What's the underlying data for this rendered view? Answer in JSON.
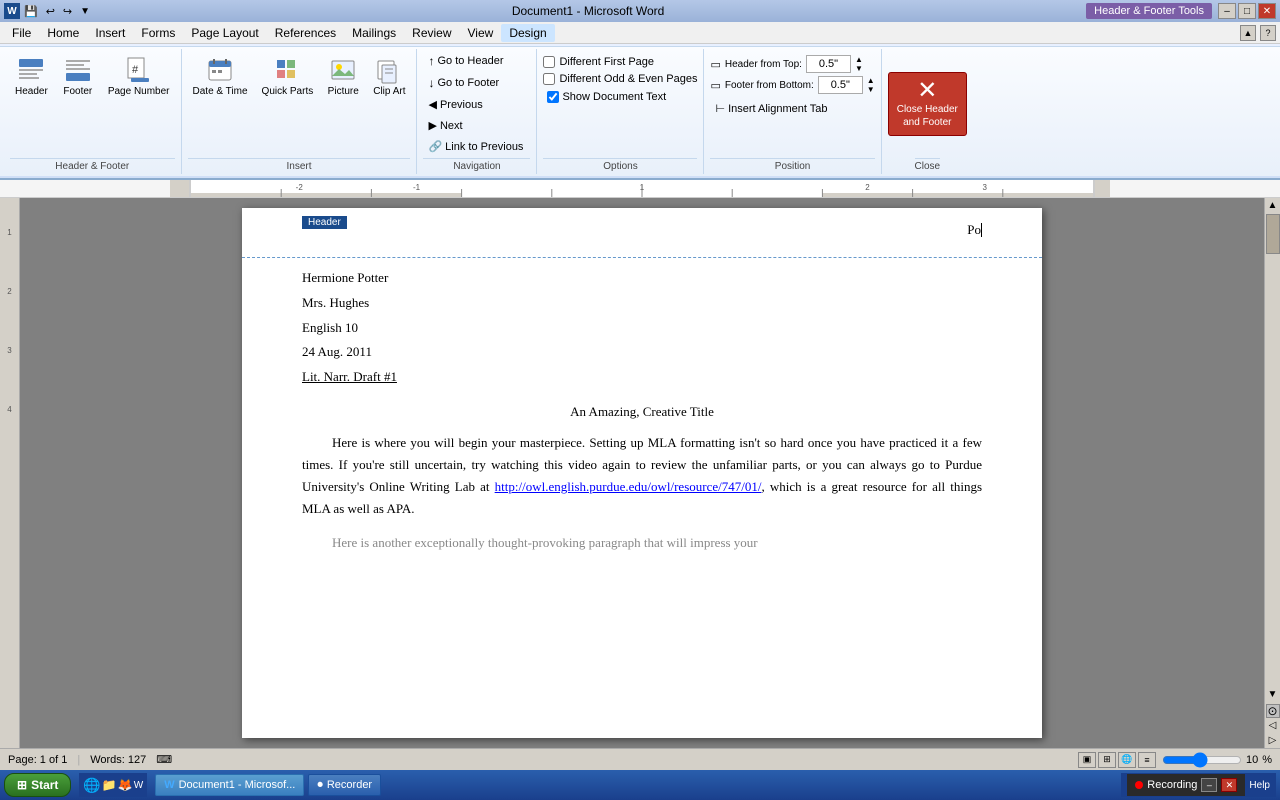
{
  "title_bar": {
    "doc_name": "Document1 - Microsoft Word",
    "header_footer_badge": "Header & Footer Tools",
    "min_btn": "–",
    "max_btn": "□",
    "close_btn": "✕"
  },
  "quick_access": {
    "save": "💾",
    "undo": "↩",
    "redo": "↪"
  },
  "ribbon": {
    "tabs": [
      {
        "label": "File",
        "id": "file"
      },
      {
        "label": "Home",
        "id": "home"
      },
      {
        "label": "Insert",
        "id": "insert"
      },
      {
        "label": "Forms",
        "id": "forms"
      },
      {
        "label": "Page Layout",
        "id": "page-layout"
      },
      {
        "label": "References",
        "id": "references"
      },
      {
        "label": "Mailings",
        "id": "mailings"
      },
      {
        "label": "Review",
        "id": "review"
      },
      {
        "label": "View",
        "id": "view"
      },
      {
        "label": "Design",
        "id": "design",
        "active": true
      }
    ],
    "groups": {
      "header_footer": {
        "label": "Header & Footer",
        "buttons": [
          {
            "id": "header",
            "label": "Header",
            "icon": "▭"
          },
          {
            "id": "footer",
            "label": "Footer",
            "icon": "▭"
          },
          {
            "id": "page-number",
            "label": "Page Number",
            "icon": "#"
          }
        ]
      },
      "insert": {
        "label": "Insert",
        "buttons": [
          {
            "id": "date-time",
            "label": "Date & Time",
            "icon": "📅"
          },
          {
            "id": "quick-parts",
            "label": "Quick Parts",
            "icon": "⬛"
          },
          {
            "id": "picture",
            "label": "Picture",
            "icon": "🖼"
          },
          {
            "id": "clip-art",
            "label": "Clip Art",
            "icon": "✂"
          }
        ]
      },
      "navigation": {
        "label": "Navigation",
        "buttons": [
          {
            "id": "previous",
            "label": "Previous"
          },
          {
            "id": "next",
            "label": "Next"
          },
          {
            "id": "link-to-previous",
            "label": "Link to Previous"
          }
        ]
      },
      "options": {
        "label": "Options",
        "items": [
          {
            "id": "diff-first-page",
            "label": "Different First Page",
            "checked": false
          },
          {
            "id": "diff-odd-even",
            "label": "Different Odd & Even Pages",
            "checked": false
          },
          {
            "id": "show-doc-text",
            "label": "Show Document Text",
            "checked": true
          }
        ]
      },
      "position": {
        "label": "Position",
        "items": [
          {
            "id": "header-from-top",
            "label": "Header from Top:",
            "value": "0.5\""
          },
          {
            "id": "footer-from-bottom",
            "label": "Footer from Bottom:",
            "value": "0.5\""
          },
          {
            "id": "insert-alignment-tab",
            "label": "Insert Alignment Tab"
          }
        ]
      },
      "close": {
        "label": "Close",
        "button_label": "Close Header\nand Footer"
      }
    }
  },
  "document": {
    "header": {
      "label": "Header",
      "page_number": "Po"
    },
    "body": {
      "author": "Hermione Potter",
      "teacher": "Mrs. Hughes",
      "class": "English 10",
      "date": "24 Aug. 2011",
      "assignment": "Lit. Narr. Draft #1",
      "title": "An Amazing, Creative Title",
      "paragraphs": [
        {
          "id": "p1",
          "indent": true,
          "text": "Here is where you will begin your masterpiece. Setting up MLA formatting isn't so hard once you have practiced it a few times. If you're still uncertain, try watching this video again to review the unfamiliar parts, or you can always go to Purdue University's Online Writing Lab at "
        },
        {
          "id": "p1-link",
          "link": "http://owl.english.purdue.edu/owl/resource/747/01/",
          "after": ", which is a great resource for all things MLA as well as APA."
        },
        {
          "id": "p2",
          "indent": true,
          "text": "Here is another exceptionally thought-provoking paragraph that will impress your"
        }
      ]
    }
  },
  "status_bar": {
    "page_info": "Page: 1 of 1",
    "words": "Words: 127",
    "zoom_percent": "10"
  },
  "taskbar": {
    "start_label": "Start",
    "items": [
      {
        "id": "word-doc",
        "label": "Document1 - Microsof...",
        "icon": "W"
      },
      {
        "id": "recorder",
        "label": "Recorder",
        "icon": "⏺"
      }
    ],
    "recording_label": "Recording"
  }
}
